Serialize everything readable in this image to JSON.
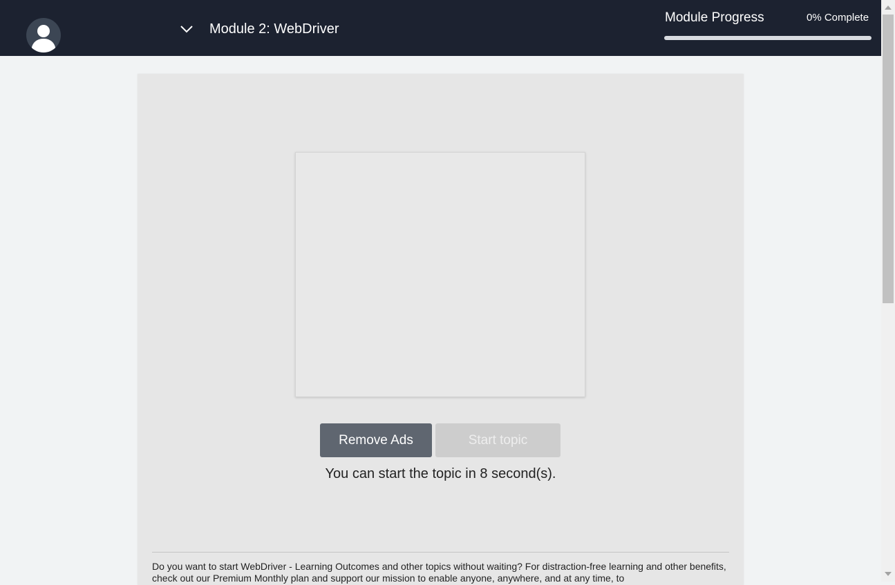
{
  "header": {
    "module_title": "Module 2: WebDriver",
    "progress_label": "Module Progress",
    "progress_text": "0% Complete",
    "progress_fraction": 0
  },
  "content": {
    "remove_ads_label": "Remove Ads",
    "start_topic_label": "Start topic",
    "countdown_text": "You can start the topic in 8 second(s).",
    "promo": {
      "text_before": "Do you want to start WebDriver - Learning Outcomes and other topics without waiting? For distraction-free learning and other benefits, check out our ",
      "link_text": "Premium Monthly",
      "text_after": " plan and support our mission to enable anyone, anywhere, and at any time, to"
    }
  },
  "icons": {
    "avatar": "user-avatar-icon",
    "chevron": "chevron-down-icon"
  },
  "colors": {
    "header_bg": "#1c2230",
    "remove_ads_bg": "#5f6670",
    "start_topic_disabled_bg": "#cdcdcd"
  }
}
